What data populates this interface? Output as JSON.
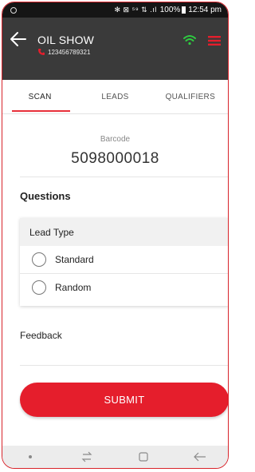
{
  "status_bar": {
    "signal_text": "✻ ⊠ ⁵⁹ ⇅ .ıl",
    "battery": "100%",
    "time": "12:54 pm"
  },
  "app_bar": {
    "title": "OIL SHOW",
    "phone": "123456789321",
    "colors": {
      "background": "#3a3a3a",
      "wifi": "#2ecc40",
      "menu": "#e51e2c"
    }
  },
  "tabs": [
    {
      "label": "SCAN",
      "active": true
    },
    {
      "label": "LEADS",
      "active": false
    },
    {
      "label": "QUALIFIERS",
      "active": false
    }
  ],
  "scan": {
    "barcode_label": "Barcode",
    "barcode_value": "5098000018"
  },
  "questions": {
    "heading": "Questions",
    "lead_type_label": "Lead Type",
    "options": [
      "Standard",
      "Random"
    ]
  },
  "feedback_label": "Feedback",
  "submit_label": "SUBMIT",
  "accent_color": "#e51e2c"
}
